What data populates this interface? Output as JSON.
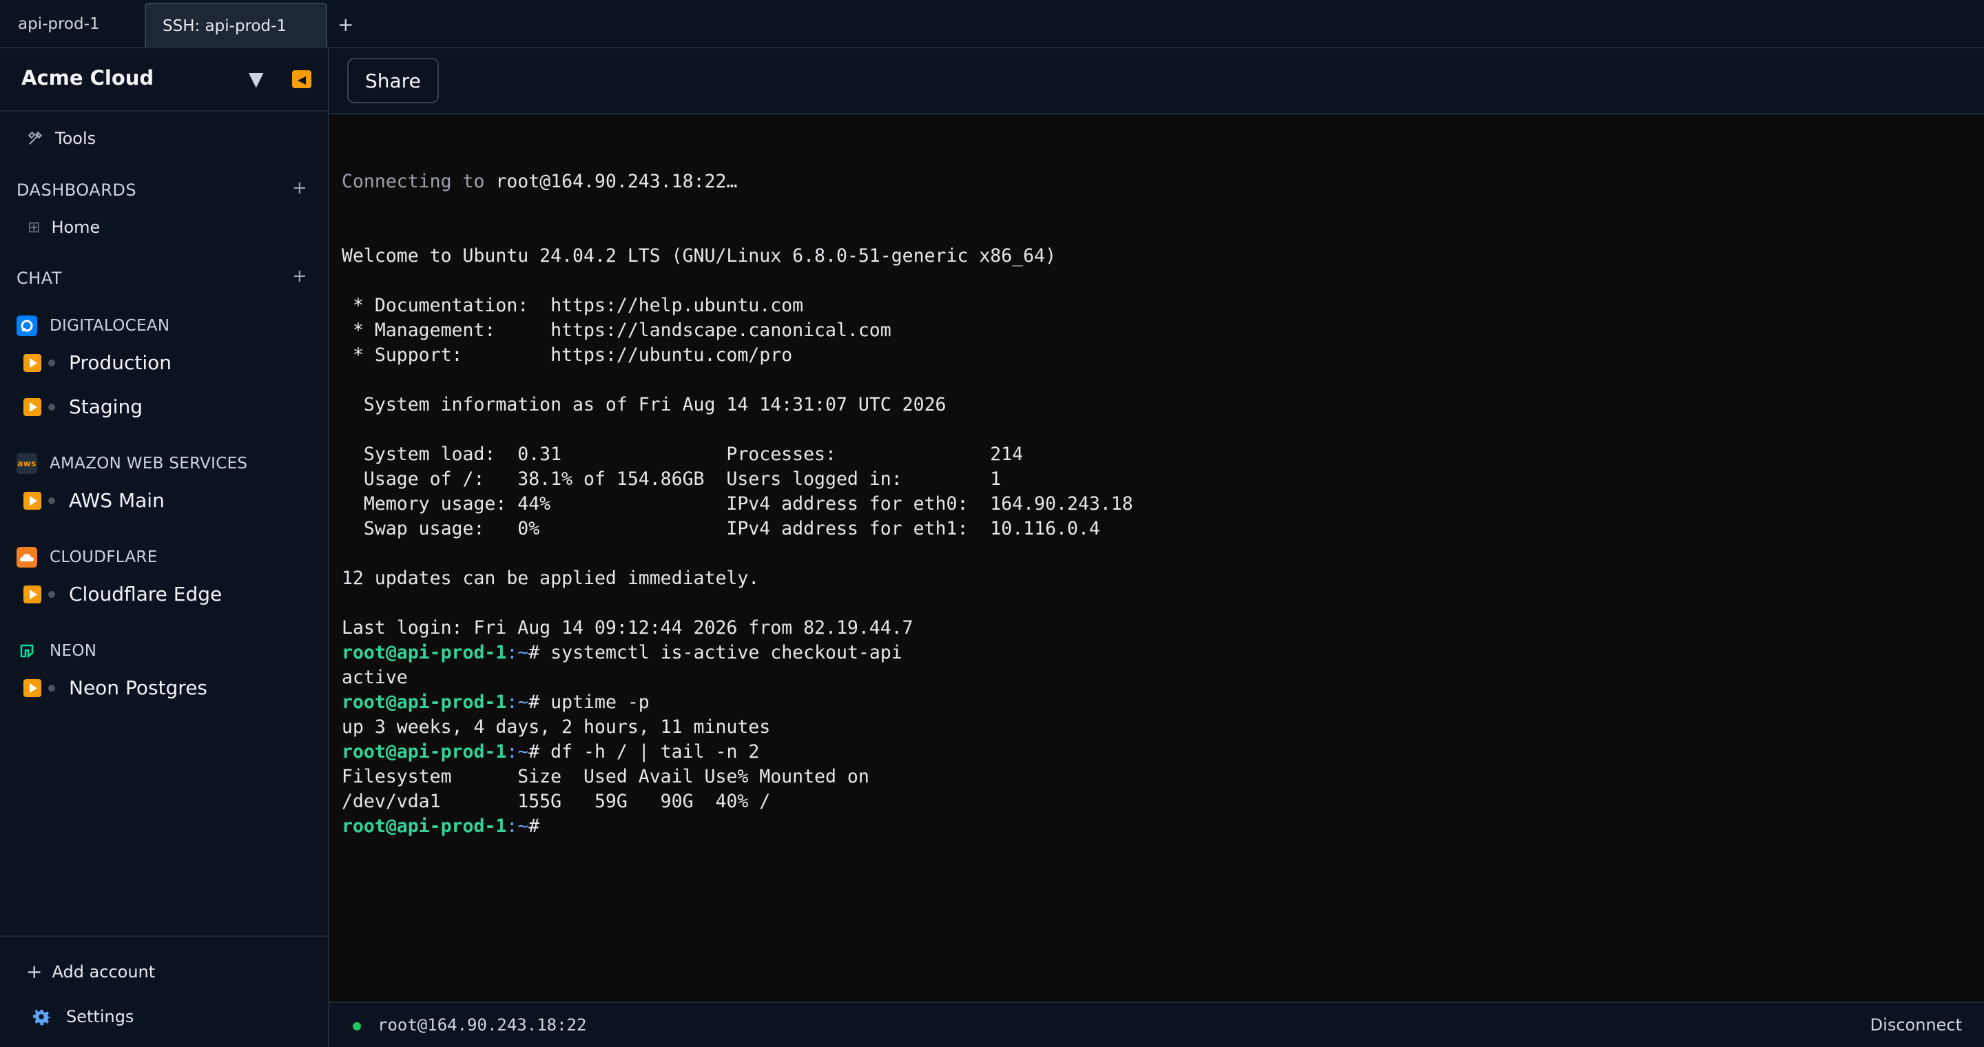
{
  "tabs": [
    {
      "label": "api-prod-1"
    },
    {
      "label": "SSH: api-prod-1"
    }
  ],
  "new_tab": "+",
  "sidebar": {
    "brand": "Acme Cloud",
    "tools": "Tools",
    "dashboards_label": "DASHBOARDS",
    "home": "Home",
    "chat_label": "CHAT",
    "providers": [
      {
        "name": "DIGITALOCEAN",
        "color": "#0080ff",
        "accounts": [
          "Production",
          "Staging"
        ]
      },
      {
        "name": "AMAZON WEB SERVICES",
        "color": "#232f3e",
        "accounts": [
          "AWS Main"
        ]
      },
      {
        "name": "CLOUDFLARE",
        "color": "#f38020",
        "accounts": [
          "Cloudflare Edge"
        ]
      },
      {
        "name": "NEON",
        "color": "#00e599",
        "accounts": [
          "Neon Postgres"
        ]
      }
    ],
    "add_account": "Add account",
    "settings": "Settings"
  },
  "toolbar": {
    "share": "Share"
  },
  "terminal": {
    "connecting_prefix": "Connecting to ",
    "connecting_host": "root@164.90.243.18:22…",
    "lines": [
      "Welcome to Ubuntu 24.04.2 LTS (GNU/Linux 6.8.0-51-generic x86_64)",
      "",
      " * Documentation:  https://help.ubuntu.com",
      " * Management:     https://landscape.canonical.com",
      " * Support:        https://ubuntu.com/pro",
      "",
      "  System information as of Fri Aug 14 14:31:07 UTC 2026",
      "",
      "  System load:  0.31               Processes:              214",
      "  Usage of /:   38.1% of 154.86GB  Users logged in:        1",
      "  Memory usage: 44%                IPv4 address for eth0:  164.90.243.18",
      "  Swap usage:   0%                 IPv4 address for eth1:  10.116.0.4",
      "",
      "12 updates can be applied immediately.",
      "",
      "Last login: Fri Aug 14 09:12:44 2026 from 82.19.44.7"
    ],
    "prompt_user": "root@api-prod-1",
    "prompt_path": ":~",
    "prompt_sym": "# ",
    "session": [
      {
        "cmd": "systemctl is-active checkout-api",
        "output": [
          "active"
        ]
      },
      {
        "cmd": "uptime -p",
        "output": [
          "up 3 weeks, 4 days, 2 hours, 11 minutes"
        ]
      },
      {
        "cmd": "df -h / | tail -n 2",
        "output": [
          "Filesystem      Size  Used Avail Use% Mounted on",
          "/dev/vda1       155G   59G   90G  40% /"
        ]
      },
      {
        "cmd": "",
        "output": []
      }
    ]
  },
  "status": {
    "host": "root@164.90.243.18:22",
    "disconnect": "Disconnect"
  }
}
